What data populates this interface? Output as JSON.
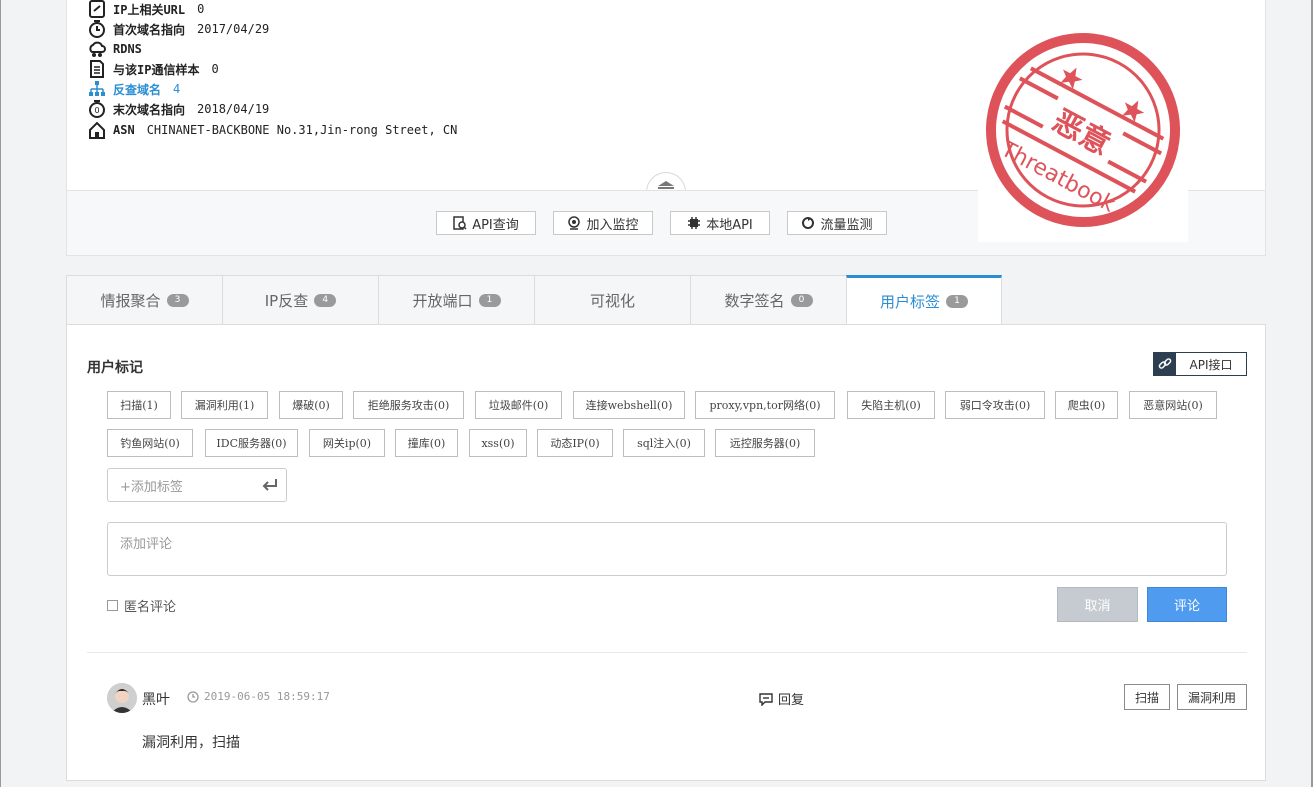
{
  "info": {
    "rows": [
      {
        "label": "IP上相关URL",
        "value": "0"
      },
      {
        "label": "首次域名指向",
        "value": "2017/04/29"
      },
      {
        "label": "RDNS",
        "value": ""
      },
      {
        "label": "与该IP通信样本",
        "value": "0"
      },
      {
        "label": "反查域名",
        "value": "4"
      },
      {
        "label": "末次域名指向",
        "value": "2018/04/19"
      },
      {
        "label": "ASN",
        "value": "CHINANET-BACKBONE No.31,Jin-rong Street, CN"
      }
    ]
  },
  "actions": {
    "api_query": "API查询",
    "add_monitor": "加入监控",
    "local_api": "本地API",
    "traffic_monitor": "流量监测"
  },
  "stamp": {
    "text_main": "恶意",
    "text_ring": "Threatbook"
  },
  "tabs": [
    {
      "label": "情报聚合",
      "count": "3"
    },
    {
      "label": "IP反查",
      "count": "4"
    },
    {
      "label": "开放端口",
      "count": "1"
    },
    {
      "label": "可视化",
      "count": ""
    },
    {
      "label": "数字签名",
      "count": "0"
    },
    {
      "label": "用户标签",
      "count": "1"
    }
  ],
  "user_tags": {
    "title": "用户标记",
    "api_button": "API接口",
    "tags": [
      "扫描(1)",
      "漏洞利用(1)",
      "爆破(0)",
      "拒绝服务攻击(0)",
      "垃圾邮件(0)",
      "连接webshell(0)",
      "proxy,vpn,tor网络(0)",
      "失陷主机(0)",
      "弱口令攻击(0)",
      "爬虫(0)",
      "恶意网站(0)",
      "钓鱼网站(0)",
      "IDC服务器(0)",
      "网关ip(0)",
      "撞库(0)",
      "xss(0)",
      "动态IP(0)",
      "sql注入(0)",
      "远控服务器(0)"
    ],
    "add_tag_placeholder": "+添加标签",
    "comment_placeholder": "添加评论",
    "anonymous_label": "匿名评论",
    "cancel_label": "取消",
    "submit_label": "评论"
  },
  "comment": {
    "user": "黑叶",
    "timestamp": "2019-06-05 18:59:17",
    "reply_label": "回复",
    "tags": [
      "扫描",
      "漏洞利用"
    ],
    "text": "漏洞利用，扫描"
  },
  "colors": {
    "accent": "#2b8ed3",
    "submit": "#4e9bf0",
    "stamp": "#d9363e"
  }
}
